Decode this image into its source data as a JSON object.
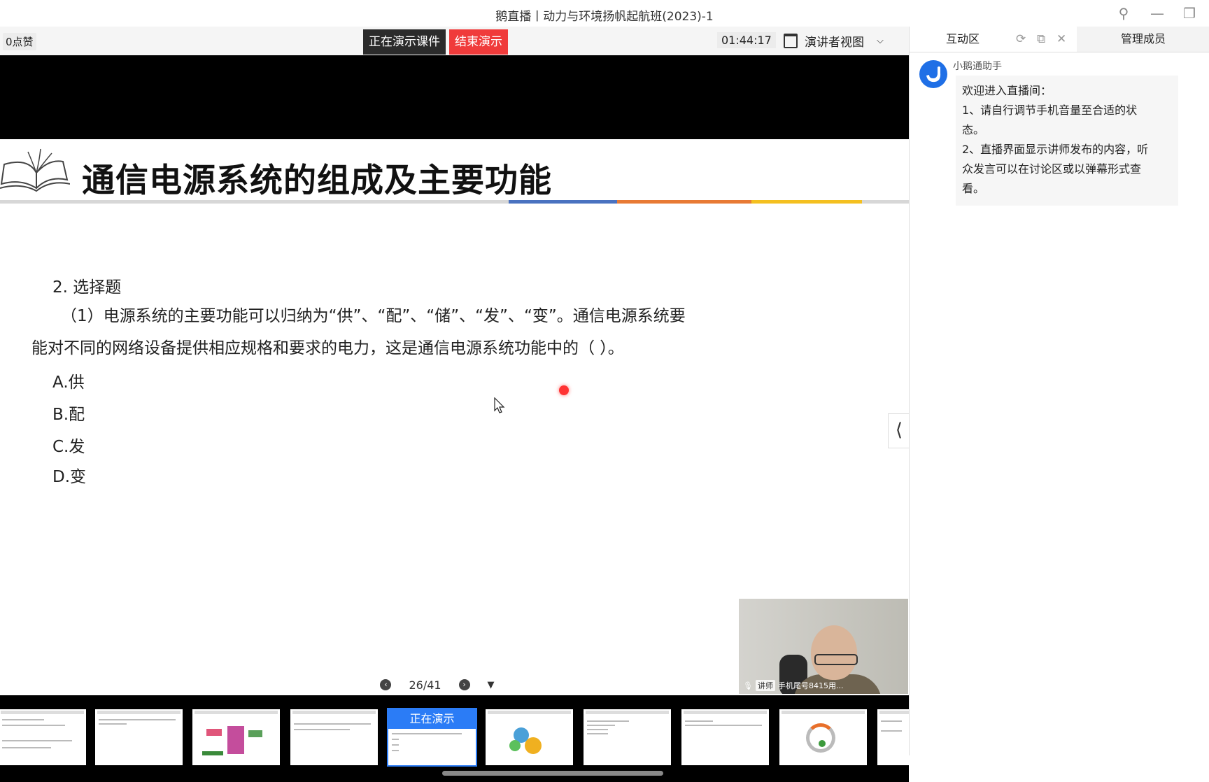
{
  "window": {
    "title": "鹅直播丨动力与环境扬帆起航班(2023)-1"
  },
  "toolbar": {
    "likes": "0点赞",
    "presenting_label": "正在演示课件",
    "end_demo_label": "结束演示",
    "timer": "01:44:17",
    "view_mode": "演讲者视图"
  },
  "slide": {
    "title": "通信电源系统的组成及主要功能",
    "question_heading": "2. 选择题",
    "question_line1": "（1）电源系统的主要功能可以归纳为“供”、“配”、“储”、“发”、“变”。通信电源系统要",
    "question_line2": "能对不同的网络设备提供相应规格和要求的电力，这是通信电源系统功能中的（  ）。",
    "options": [
      "A.供",
      "B.配",
      "C.发",
      "D.变"
    ],
    "accent_colors": [
      "#4a72c0",
      "#e87a35",
      "#f4c020"
    ]
  },
  "webcam": {
    "role_tag": "讲师",
    "caption": "手机尾号8415用..."
  },
  "pager": {
    "page": "26/41"
  },
  "thumbnails": {
    "current_label": "正在演示"
  },
  "panel": {
    "tab_interaction": "互动区",
    "tab_members": "管理成员",
    "message": {
      "sender": "小鹅通助手",
      "lines": [
        "欢迎进入直播间：",
        "1、请自行调节手机音量至合适的状",
        "态。",
        "2、直播界面显示讲师发布的内容，听",
        "众发言可以在讨论区或以弹幕形式查",
        "看。"
      ]
    }
  }
}
